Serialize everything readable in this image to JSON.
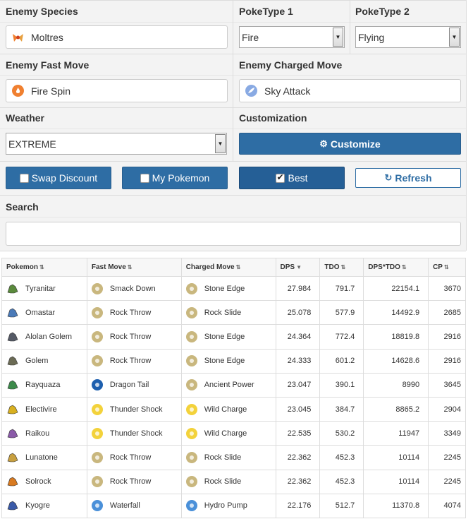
{
  "form": {
    "enemy_species_label": "Enemy Species",
    "enemy_species_value": "Moltres",
    "poketype1_label": "PokeType 1",
    "poketype1_value": "Fire",
    "poketype2_label": "PokeType 2",
    "poketype2_value": "Flying",
    "fast_move_label": "Enemy Fast Move",
    "fast_move_value": "Fire Spin",
    "charged_move_label": "Enemy Charged Move",
    "charged_move_value": "Sky Attack",
    "weather_label": "Weather",
    "weather_value": "EXTREME",
    "customization_label": "Customization",
    "customize_button": "Customize",
    "swap_discount": "Swap Discount",
    "my_pokemon": "My Pokemon",
    "best": "Best",
    "refresh": "Refresh",
    "search_label": "Search",
    "search_value": ""
  },
  "table": {
    "headers": [
      "Pokemon",
      "Fast Move",
      "Charged Move",
      "DPS",
      "TDO",
      "DPS*TDO",
      "CP"
    ],
    "rows": [
      {
        "pokemon": "Tyranitar",
        "fast": "Smack Down",
        "charged": "Stone Edge",
        "dps": "27.984",
        "tdo": "791.7",
        "dpstdo": "22154.1",
        "cp": "3670",
        "fast_type": "rock",
        "charged_type": "rock",
        "poke_color": "#5a8a3c"
      },
      {
        "pokemon": "Omastar",
        "fast": "Rock Throw",
        "charged": "Rock Slide",
        "dps": "25.078",
        "tdo": "577.9",
        "dpstdo": "14492.9",
        "cp": "2685",
        "fast_type": "rock",
        "charged_type": "rock",
        "poke_color": "#4a7ab8"
      },
      {
        "pokemon": "Alolan Golem",
        "fast": "Rock Throw",
        "charged": "Stone Edge",
        "dps": "24.364",
        "tdo": "772.4",
        "dpstdo": "18819.8",
        "cp": "2916",
        "fast_type": "rock",
        "charged_type": "rock",
        "poke_color": "#555a66"
      },
      {
        "pokemon": "Golem",
        "fast": "Rock Throw",
        "charged": "Stone Edge",
        "dps": "24.333",
        "tdo": "601.2",
        "dpstdo": "14628.6",
        "cp": "2916",
        "fast_type": "rock",
        "charged_type": "rock",
        "poke_color": "#6b6b55"
      },
      {
        "pokemon": "Rayquaza",
        "fast": "Dragon Tail",
        "charged": "Ancient Power",
        "dps": "23.047",
        "tdo": "390.1",
        "dpstdo": "8990",
        "cp": "3645",
        "fast_type": "dragon",
        "charged_type": "rock",
        "poke_color": "#3c8a4a"
      },
      {
        "pokemon": "Electivire",
        "fast": "Thunder Shock",
        "charged": "Wild Charge",
        "dps": "23.045",
        "tdo": "384.7",
        "dpstdo": "8865.2",
        "cp": "2904",
        "fast_type": "electric",
        "charged_type": "electric",
        "poke_color": "#d8b020"
      },
      {
        "pokemon": "Raikou",
        "fast": "Thunder Shock",
        "charged": "Wild Charge",
        "dps": "22.535",
        "tdo": "530.2",
        "dpstdo": "11947",
        "cp": "3349",
        "fast_type": "electric",
        "charged_type": "electric",
        "poke_color": "#8a5aa8"
      },
      {
        "pokemon": "Lunatone",
        "fast": "Rock Throw",
        "charged": "Rock Slide",
        "dps": "22.362",
        "tdo": "452.3",
        "dpstdo": "10114",
        "cp": "2245",
        "fast_type": "rock",
        "charged_type": "rock",
        "poke_color": "#c8a040"
      },
      {
        "pokemon": "Solrock",
        "fast": "Rock Throw",
        "charged": "Rock Slide",
        "dps": "22.362",
        "tdo": "452.3",
        "dpstdo": "10114",
        "cp": "2245",
        "fast_type": "rock",
        "charged_type": "rock",
        "poke_color": "#d87a20"
      },
      {
        "pokemon": "Kyogre",
        "fast": "Waterfall",
        "charged": "Hydro Pump",
        "dps": "22.176",
        "tdo": "512.7",
        "dpstdo": "11370.8",
        "cp": "4074",
        "fast_type": "water",
        "charged_type": "water",
        "poke_color": "#3a5aa8"
      }
    ]
  },
  "colors": {
    "rock": "#c9b77e",
    "dragon": "#1d5fae",
    "electric": "#f3d23b",
    "water": "#4a90d9",
    "fire": "#f08030",
    "flying": "#89aae3",
    "primary": "#2e6da4"
  },
  "icons": {
    "customize": "gear-icon",
    "refresh": "refresh-icon",
    "sort": "sort-icon",
    "sort_desc": "sort-desc-icon"
  }
}
